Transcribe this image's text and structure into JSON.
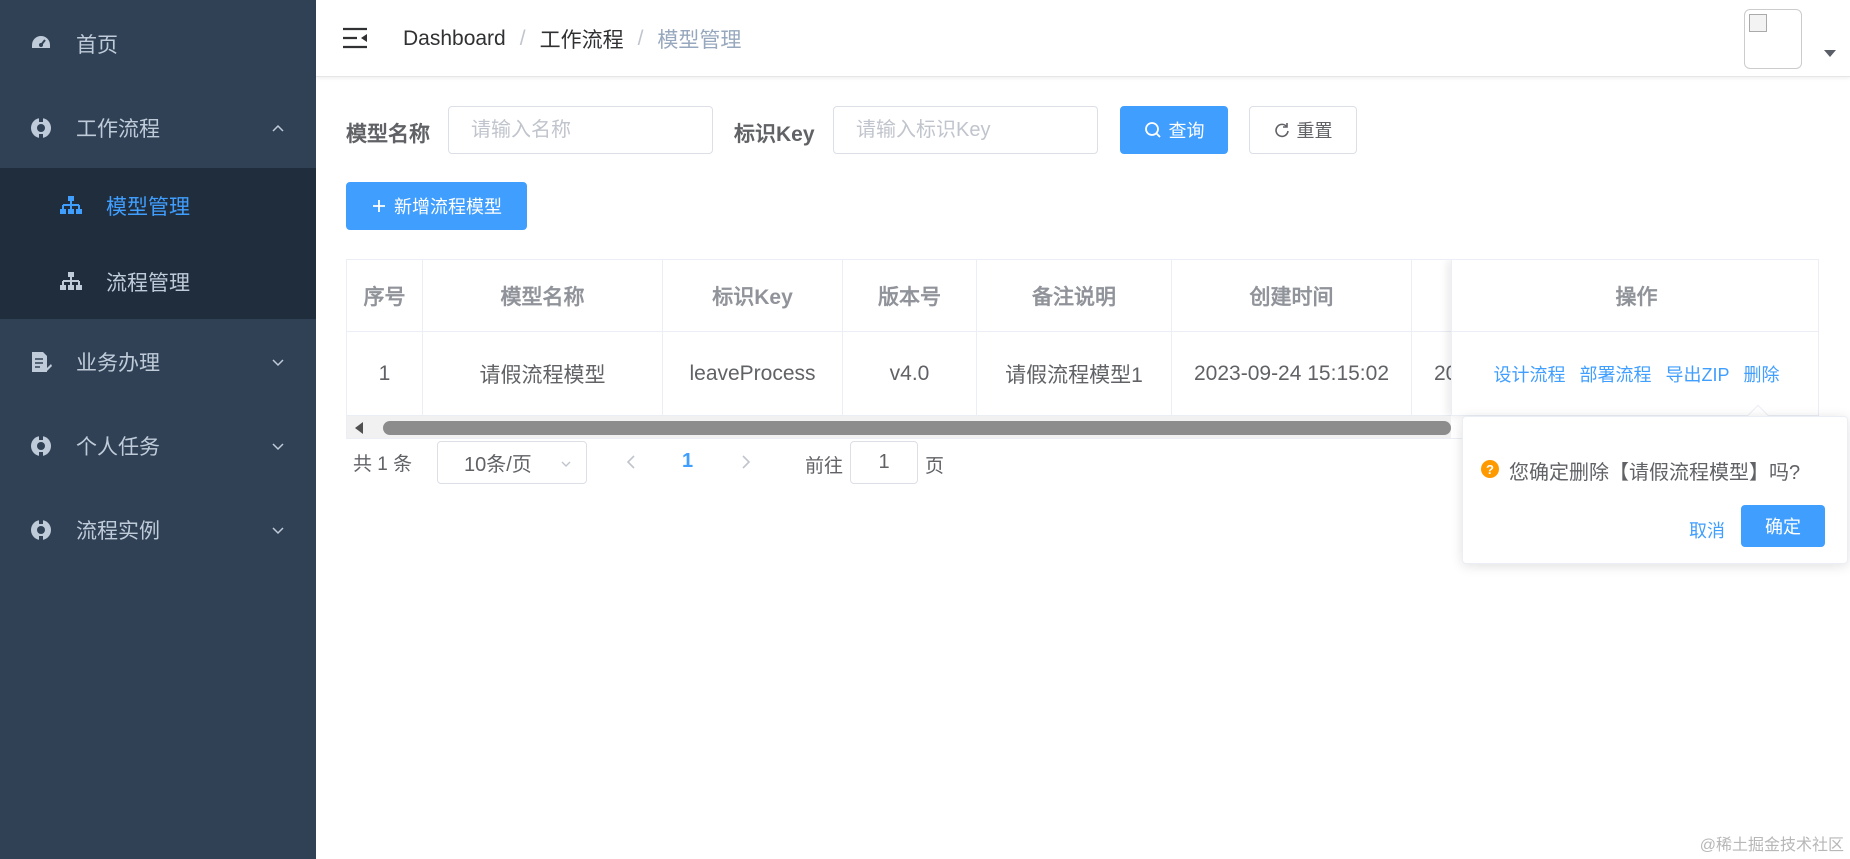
{
  "sidebar": {
    "items": [
      {
        "label": "首页",
        "icon": "dashboard-icon"
      },
      {
        "label": "工作流程",
        "icon": "workflow-icon",
        "expanded": true
      },
      {
        "label": "业务办理",
        "icon": "document-edit-icon"
      },
      {
        "label": "个人任务",
        "icon": "task-icon"
      },
      {
        "label": "流程实例",
        "icon": "instance-icon"
      }
    ],
    "subitems": [
      {
        "label": "模型管理",
        "icon": "tree-icon",
        "active": true
      },
      {
        "label": "流程管理",
        "icon": "tree-icon"
      }
    ],
    "bg_color": "#304156",
    "active_color": "#409eff"
  },
  "header": {
    "breadcrumb": [
      "Dashboard",
      "工作流程",
      "模型管理"
    ],
    "separator": "/"
  },
  "search": {
    "name_label": "模型名称",
    "name_placeholder": "请输入名称",
    "key_label": "标识Key",
    "key_placeholder": "请输入标识Key",
    "query_label": "查询",
    "reset_label": "重置"
  },
  "toolbar": {
    "add_label": "新增流程模型"
  },
  "table": {
    "headers": [
      "序号",
      "模型名称",
      "标识Key",
      "版本号",
      "备注说明",
      "创建时间",
      "",
      "操作"
    ],
    "rows": [
      {
        "index": "1",
        "name": "请假流程模型",
        "key": "leaveProcess",
        "version": "v4.0",
        "remark": "请假流程模型1",
        "created": "2023-09-24 15:15:02",
        "truncated": "20"
      }
    ],
    "actions": [
      "设计流程",
      "部署流程",
      "导出ZIP",
      "删除"
    ]
  },
  "pagination": {
    "total": "共 1 条",
    "page_size": "10条/页",
    "current": "1",
    "goto_label": "前往",
    "goto_value": "1",
    "page_unit": "页"
  },
  "popconfirm": {
    "icon": "?",
    "message": "您确定删除【请假流程模型】吗?",
    "cancel": "取消",
    "confirm": "确定"
  },
  "watermark": "@稀土掘金技术社区",
  "colors": {
    "primary": "#409eff",
    "warning": "#ff9900"
  }
}
